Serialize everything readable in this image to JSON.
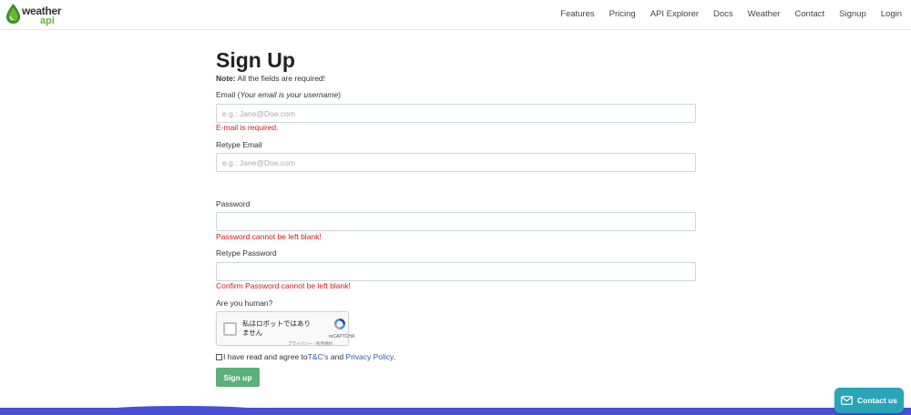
{
  "header": {
    "logo": {
      "word1": "weather",
      "word2": "api"
    },
    "nav": [
      {
        "label": "Features",
        "name": "nav-features"
      },
      {
        "label": "Pricing",
        "name": "nav-pricing"
      },
      {
        "label": "API Explorer",
        "name": "nav-api-explorer"
      },
      {
        "label": "Docs",
        "name": "nav-docs"
      },
      {
        "label": "Weather",
        "name": "nav-weather"
      },
      {
        "label": "Contact",
        "name": "nav-contact"
      },
      {
        "label": "Signup",
        "name": "nav-signup"
      },
      {
        "label": "Login",
        "name": "nav-login"
      }
    ]
  },
  "form": {
    "title": "Sign Up",
    "note_bold": "Note:",
    "note_text": " All the fields are required!",
    "email": {
      "label": "Email (",
      "label_italic": "Your email is your username",
      "label_end": ")",
      "placeholder": "e.g.: Jane@Doe.com",
      "value": "",
      "error": "E-mail is required."
    },
    "retype_email": {
      "label": "Retype Email",
      "placeholder": "e.g.: Jane@Doe.com",
      "value": ""
    },
    "password": {
      "label": "Password",
      "value": "",
      "error": "Password cannot be left blank!"
    },
    "retype_password": {
      "label": "Retype Password",
      "value": "",
      "error": "Confirm Password cannot be left blank!"
    },
    "human": {
      "label": "Are you human?",
      "captcha_text": "私はロボットではありません",
      "captcha_brand": "reCAPTCHA",
      "captcha_links": "プライバシー - 利用規約"
    },
    "agree": {
      "text": "I have read and agree to",
      "tc_link": "T&C's",
      "and": " and ",
      "privacy_link": "Privacy Policy",
      "end": "."
    },
    "submit_label": "Sign up"
  },
  "contact_button": {
    "label": "Contact us"
  },
  "colors": {
    "error": "#d9171b",
    "button": "#5cb07a",
    "link": "#2e59a8",
    "contact": "#2aa5b8",
    "footer": "#4a4fd6",
    "logo_green": "#67b832"
  }
}
